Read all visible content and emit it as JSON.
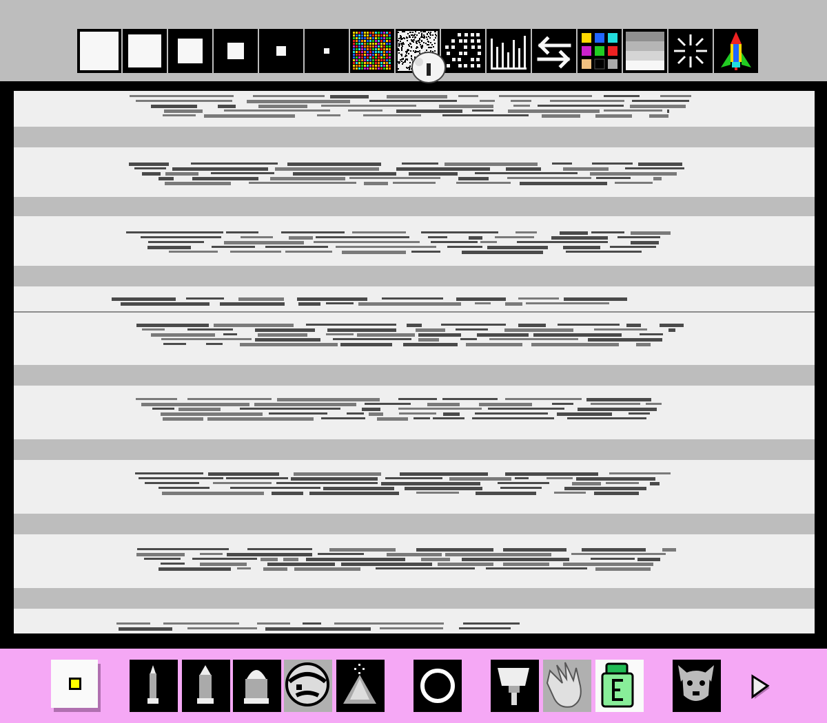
{
  "app": {
    "name": "paint-program",
    "colors": {
      "top_bar": "#bdbdbd",
      "canvas_bg": "#efefef",
      "canvas_band": "#bdbdbd",
      "bottom_bar": "#f5a8f5",
      "selected_color": "#ffff00"
    }
  },
  "top_toolbar": {
    "tools": [
      {
        "name": "brush-size-1-icon"
      },
      {
        "name": "brush-size-2-icon"
      },
      {
        "name": "brush-size-3-icon"
      },
      {
        "name": "brush-size-4-icon"
      },
      {
        "name": "brush-size-5-icon"
      },
      {
        "name": "brush-size-6-icon"
      },
      {
        "name": "confetti-pattern-icon"
      },
      {
        "name": "noise-pattern-icon"
      },
      {
        "name": "dots-pattern-icon"
      },
      {
        "name": "bars-pattern-icon"
      },
      {
        "name": "swap-arrows-icon"
      },
      {
        "name": "color-grid-icon"
      },
      {
        "name": "gradient-icon"
      },
      {
        "name": "sparkle-icon"
      },
      {
        "name": "rocket-icon"
      }
    ]
  },
  "bottom_toolbar": {
    "tools": [
      {
        "name": "current-color-swatch"
      },
      {
        "name": "thin-pencil-icon"
      },
      {
        "name": "medium-pencil-icon"
      },
      {
        "name": "thick-pencil-icon"
      },
      {
        "name": "mario-stamp-icon"
      },
      {
        "name": "spray-can-icon"
      },
      {
        "name": "circle-shape-icon"
      },
      {
        "name": "paint-roller-icon"
      },
      {
        "name": "glove-icon"
      },
      {
        "name": "eraser-icon"
      },
      {
        "name": "dog-icon"
      },
      {
        "name": "next-arrow-icon"
      }
    ]
  }
}
